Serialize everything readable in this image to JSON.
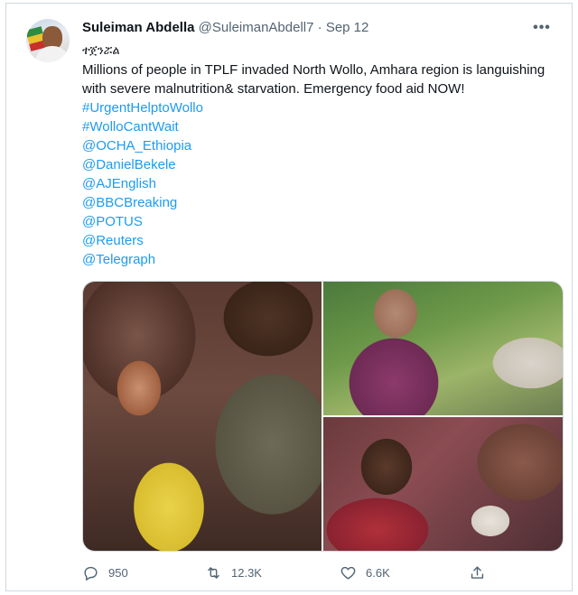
{
  "tweet": {
    "author": {
      "name": "Suleiman Abdella",
      "handle": "@SuleimanAbdell7",
      "separator": "·",
      "date": "Sep 12"
    },
    "more_label": "•••",
    "lines": {
      "script": "ተጀንሯል",
      "body": "Millions of people in TPLF invaded North Wollo, Amhara region is languishing with severe malnutrition& starvation. Emergency food aid NOW!"
    },
    "hashtags": [
      "#UrgentHelptoWollo",
      "#WolloCantWait"
    ],
    "mentions": [
      "@OCHA_Ethiopia",
      "@DanielBekele",
      "@AJEnglish",
      "@BBCBreaking",
      "@POTUS",
      "@Reuters",
      "@Telegraph"
    ],
    "actions": {
      "reply_count": "950",
      "retweet_count": "12.3K",
      "like_count": "6.6K"
    }
  },
  "colors": {
    "text": "#0f1419",
    "secondary": "#536471",
    "link": "#1d9bf0",
    "border": "#cfd9de"
  },
  "icons": [
    "reply-icon",
    "retweet-icon",
    "like-icon",
    "share-icon",
    "more-icon"
  ]
}
